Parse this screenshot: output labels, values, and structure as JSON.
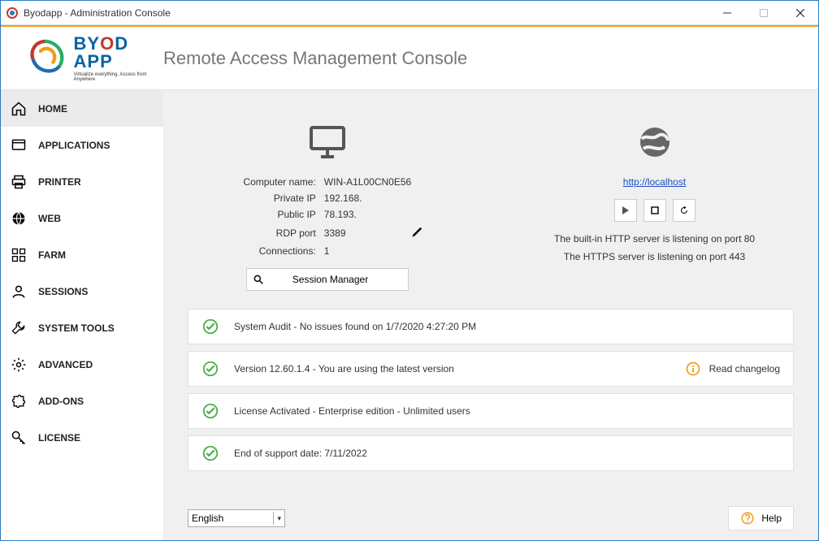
{
  "window": {
    "title": "Byodapp - Administration Console"
  },
  "header": {
    "logo_top": "BYOD",
    "logo_bot": "APP",
    "logo_sub": "Virtualize everything. Access from Anywhere",
    "title": "Remote Access Management Console"
  },
  "sidebar": {
    "items": [
      {
        "label": "HOME"
      },
      {
        "label": "APPLICATIONS"
      },
      {
        "label": "PRINTER"
      },
      {
        "label": "WEB"
      },
      {
        "label": "FARM"
      },
      {
        "label": "SESSIONS"
      },
      {
        "label": "SYSTEM TOOLS"
      },
      {
        "label": "ADVANCED"
      },
      {
        "label": "ADD-ONS"
      },
      {
        "label": "LICENSE"
      }
    ]
  },
  "computer": {
    "name_label": "Computer name:",
    "name": "WIN-A1L00CN0E56",
    "private_ip_label": "Private IP",
    "private_ip": "192.168.",
    "public_ip_label": "Public IP",
    "public_ip": "78.193.",
    "rdp_port_label": "RDP port",
    "rdp_port": "3389",
    "connections_label": "Connections:",
    "connections": "1",
    "session_manager": "Session Manager"
  },
  "web": {
    "url": "http://localhost",
    "http_status": "The built-in HTTP server is listening on port 80",
    "https_status": "The HTTPS server is listening on port 443"
  },
  "status": {
    "audit": "System Audit - No issues found on 1/7/2020 4:27:20 PM",
    "version": "Version 12.60.1.4 - You are using the latest version",
    "changelog": "Read changelog",
    "license": "License Activated - Enterprise edition - Unlimited users",
    "support": "End of support date: 7/11/2022"
  },
  "footer": {
    "language": "English",
    "help": "Help"
  }
}
